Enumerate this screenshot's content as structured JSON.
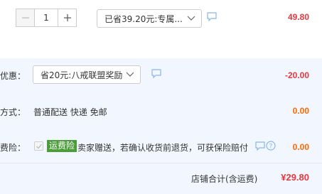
{
  "item": {
    "quantity": "1",
    "promo_select": "已省39.20元:专属...",
    "price": "49.80"
  },
  "coupon": {
    "label": "优惠：",
    "select": "省20元:八戒联盟奖励",
    "amount": "-20.00"
  },
  "shipping": {
    "label": "方式：",
    "text": "普通配送 快递 免邮",
    "amount": "0.00"
  },
  "insurance": {
    "label": "费险：",
    "badge": "运费险",
    "text": "卖家赠送，若确认收货前退货，可获保险赔付",
    "amount": "0.00"
  },
  "total": {
    "label": "店铺合计(含运费)",
    "amount": "¥29.80"
  },
  "colors": {
    "price_red": "#e4393c",
    "amount_orange": "#ff6600",
    "panel_bg": "#f2f7ff",
    "badge_green": "#4a9d3a",
    "icon_blue": "#8ab4e8"
  },
  "icons": [
    "minus-icon",
    "plus-icon",
    "chevron-down-icon",
    "message-icon",
    "help-icon",
    "check-icon"
  ]
}
